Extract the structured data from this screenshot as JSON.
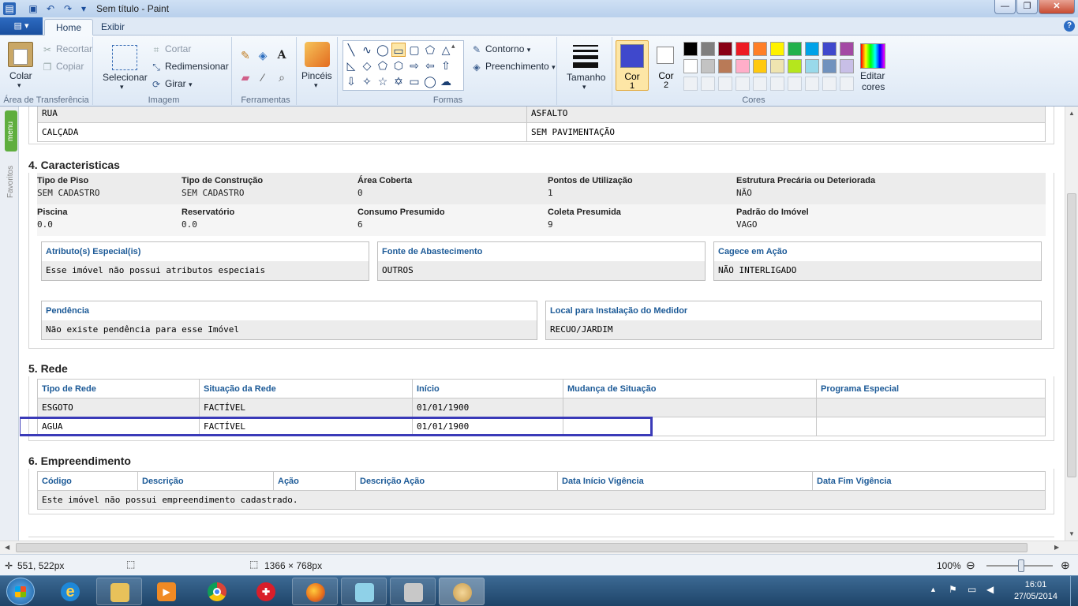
{
  "window": {
    "title": "Sem título - Paint",
    "minimize": "—",
    "maximize": "❐",
    "close": "✕"
  },
  "tabs": {
    "app_menu": "▤ ▾",
    "home": "Home",
    "view": "Exibir",
    "help": "?"
  },
  "ribbon": {
    "clipboard": {
      "paste": "Colar",
      "cut": "Recortar",
      "copy": "Copiar",
      "label": "Área de Transferência"
    },
    "image": {
      "select": "Selecionar",
      "crop": "Cortar",
      "resize": "Redimensionar",
      "rotate": "Girar",
      "label": "Imagem"
    },
    "tools": {
      "label": "Ferramentas"
    },
    "brushes": {
      "label": "Pincéis"
    },
    "shapes": {
      "outline": "Contorno",
      "fill": "Preenchimento",
      "label": "Formas"
    },
    "size": {
      "label": "Tamanho"
    },
    "colors": {
      "color1": "Cor",
      "color1_num": "1",
      "color2": "Cor",
      "color2_num": "2",
      "edit": "Editar",
      "edit2": "cores",
      "label": "Cores",
      "row1": [
        "#000000",
        "#7f7f7f",
        "#880015",
        "#ed1c24",
        "#ff7f27",
        "#fff200",
        "#22b14c",
        "#00a2e8",
        "#3f48cc",
        "#a349a4"
      ],
      "row2": [
        "#ffffff",
        "#c3c3c3",
        "#b97a57",
        "#ffaec9",
        "#ffc90e",
        "#efe4b0",
        "#b5e61d",
        "#99d9ea",
        "#7092be",
        "#c8bfe7"
      ],
      "color1_value": "#3f48cc",
      "color2_value": "#ffffff"
    }
  },
  "side": {
    "menu": "menu",
    "favorites": "Favoritos"
  },
  "doc": {
    "top_rows": [
      [
        "RUA",
        "ASFALTO"
      ],
      [
        "CALÇADA",
        "SEM PAVIMENTAÇÃO"
      ]
    ],
    "sec4": {
      "title": "4. Caracteristicas",
      "fields": [
        {
          "label": "Tipo de Piso",
          "value": "SEM CADASTRO"
        },
        {
          "label": "Tipo de Construção",
          "value": "SEM CADASTRO"
        },
        {
          "label": "Área Coberta",
          "value": "0"
        },
        {
          "label": "Pontos de Utilização",
          "value": "1"
        },
        {
          "label": "Estrutura Precária ou Deteriorada",
          "value": "NÃO"
        },
        {
          "label": "Piscina",
          "value": "0.0"
        },
        {
          "label": "Reservatório",
          "value": "0.0"
        },
        {
          "label": "Consumo Presumido",
          "value": "6"
        },
        {
          "label": "Coleta Presumida",
          "value": "9"
        },
        {
          "label": "Padrão do Imóvel",
          "value": "VAGO"
        }
      ],
      "boxes": [
        {
          "title": "Atributo(s) Especial(is)",
          "value": "Esse imóvel não possui atributos especiais"
        },
        {
          "title": "Fonte de Abastecimento",
          "value": "OUTROS"
        },
        {
          "title": "Cagece em Ação",
          "value": "NÃO INTERLIGADO"
        },
        {
          "title": "Pendência",
          "value": "Não existe pendência para esse Imóvel"
        },
        {
          "title": "Local para Instalação do Medidor",
          "value": "RECUO/JARDIM"
        }
      ]
    },
    "sec5": {
      "title": "5. Rede",
      "headers": [
        "Tipo de Rede",
        "Situação da Rede",
        "Início",
        "Mudança de Situação",
        "Programa Especial"
      ],
      "rows": [
        [
          "ESGOTO",
          "FACTÍVEL",
          "01/01/1900",
          "",
          ""
        ],
        [
          "AGUA",
          "FACTÍVEL",
          "01/01/1900",
          "",
          ""
        ]
      ]
    },
    "sec6": {
      "title": "6. Empreendimento",
      "headers": [
        "Código",
        "Descrição",
        "Ação",
        "Descrição Ação",
        "Data Início Vigência",
        "Data Fim Vigência"
      ],
      "empty": "Este imóvel não possui empreendimento cadastrado."
    }
  },
  "selection_color": "#3a3ab8",
  "status": {
    "cursor": "551, 522px",
    "size": "1366 × 768px",
    "zoom": "100%",
    "zoom_level": 100
  },
  "taskbar": {
    "time": "16:01",
    "date": "27/05/2014"
  }
}
